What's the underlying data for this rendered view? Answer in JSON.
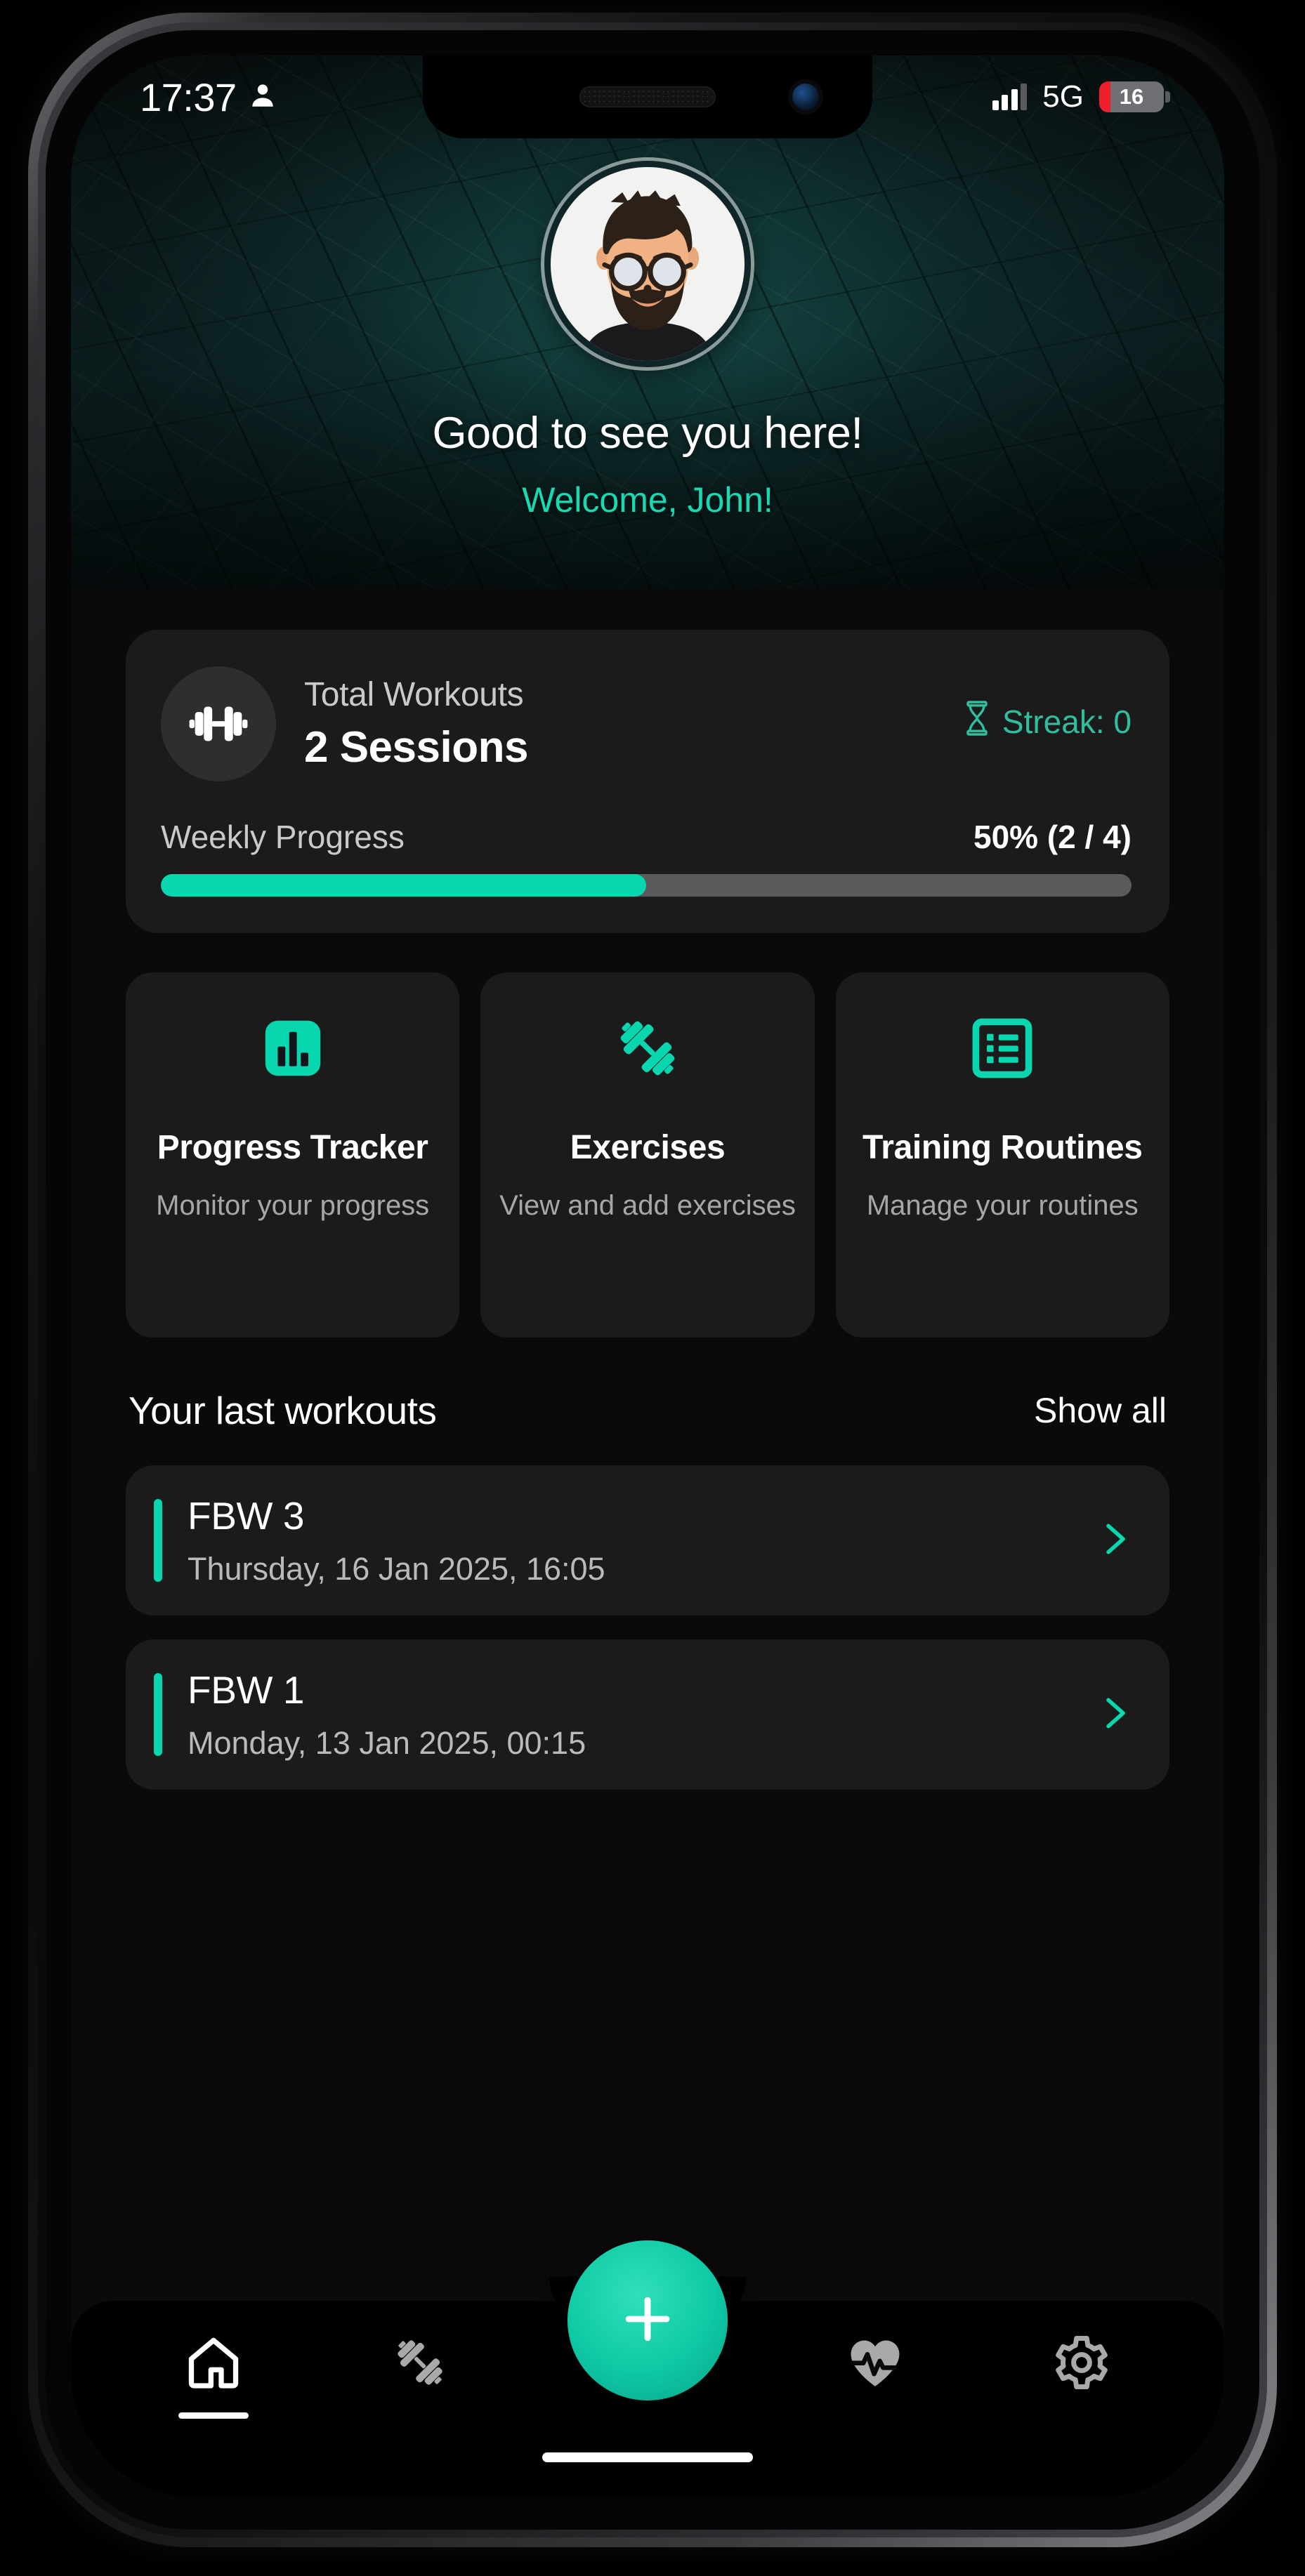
{
  "status_bar": {
    "time": "17:37",
    "person_icon": "person-icon",
    "signal_icon": "signal-bars-icon",
    "network": "5G",
    "battery_level": "16",
    "battery_icon": "battery-low-icon"
  },
  "header": {
    "avatar_alt": "user-avatar",
    "greeting": "Good to see you here!",
    "welcome": "Welcome, John!"
  },
  "stats": {
    "icon": "dumbbell-icon",
    "label": "Total Workouts",
    "value": "2 Sessions",
    "streak_icon": "hourglass-icon",
    "streak": "Streak: 0",
    "progress_label": "Weekly Progress",
    "progress_value": "50% (2 / 4)",
    "progress_percent": 50
  },
  "features": [
    {
      "icon": "bar-chart-icon",
      "title": "Progress Tracker",
      "desc": "Monitor your progress"
    },
    {
      "icon": "dumbbell-diagonal-icon",
      "title": "Exercises",
      "desc": "View and add exercises"
    },
    {
      "icon": "list-icon",
      "title": "Training Routines",
      "desc": "Manage your routines"
    }
  ],
  "workouts_section": {
    "title": "Your last workouts",
    "show_all": "Show all",
    "items": [
      {
        "name": "FBW 3",
        "date": "Thursday, 16 Jan 2025, 16:05",
        "chevron": "chevron-right-icon"
      },
      {
        "name": "FBW 1",
        "date": "Monday, 13 Jan 2025, 00:15",
        "chevron": "chevron-right-icon"
      }
    ]
  },
  "bottom_nav": {
    "items": [
      {
        "icon": "home-icon",
        "active": true
      },
      {
        "icon": "dumbbell-nav-icon",
        "active": false
      },
      {
        "icon": "heart-pulse-icon",
        "active": false
      },
      {
        "icon": "gear-icon",
        "active": false
      }
    ],
    "fab_icon": "plus-icon"
  },
  "colors": {
    "accent": "#07d6ae",
    "accent_text": "#17d9b2",
    "card_bg": "#1b1b1c",
    "screen_bg": "#0a0a0a",
    "battery_low": "#f01d2b"
  }
}
